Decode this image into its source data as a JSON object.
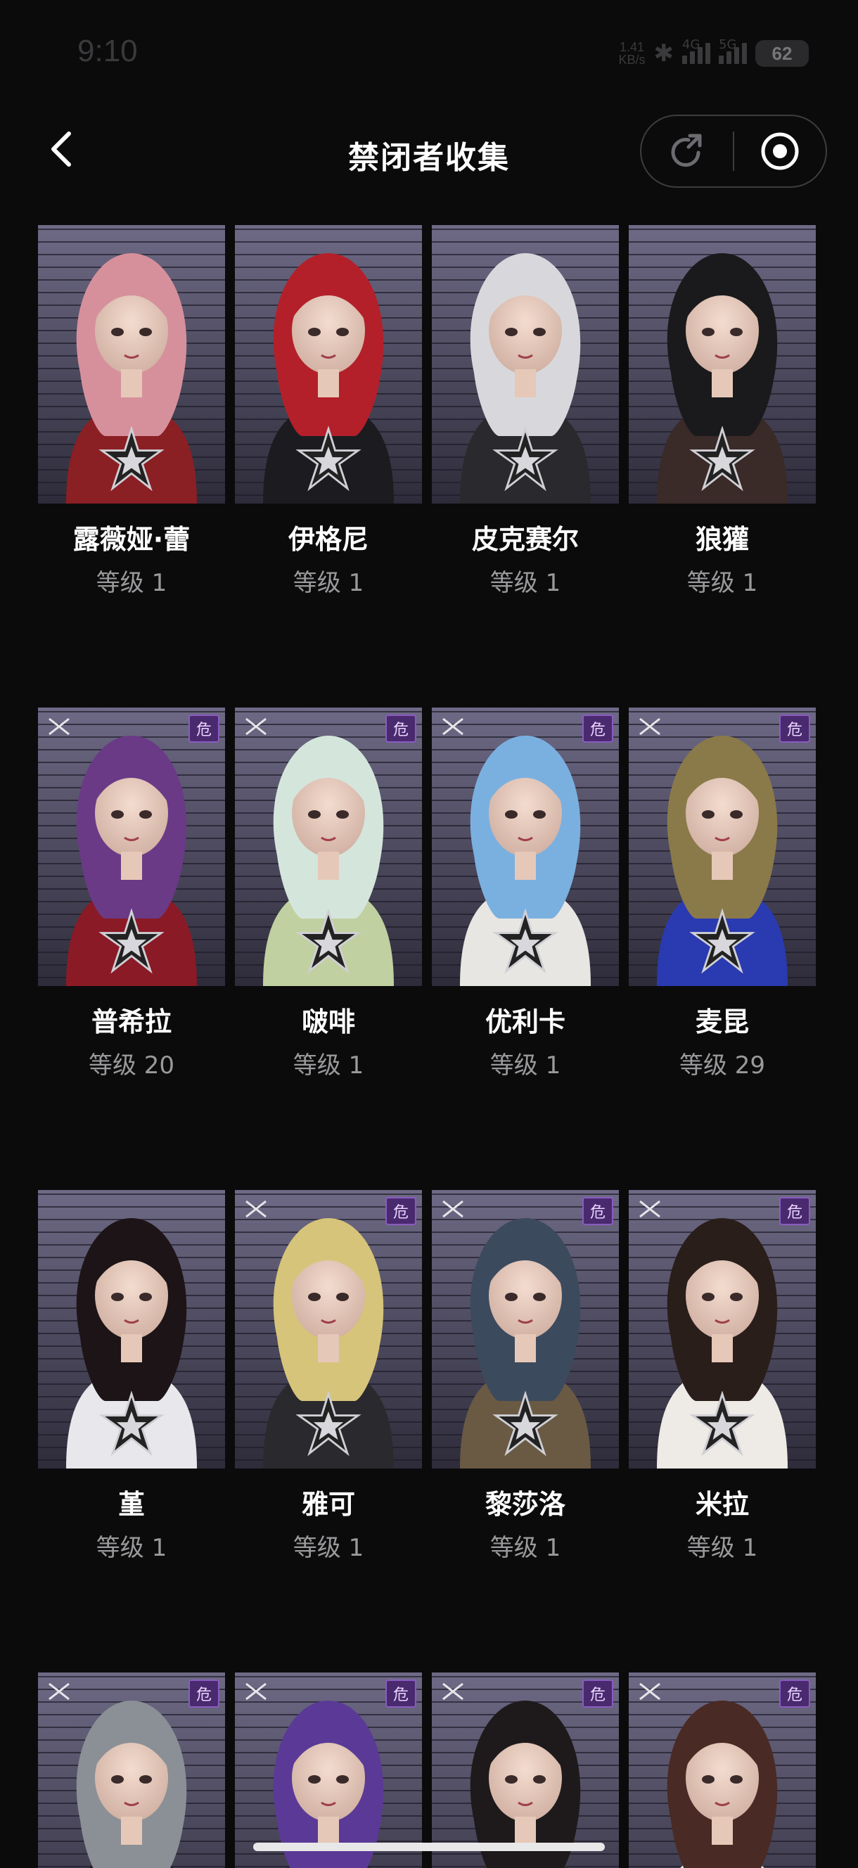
{
  "status": {
    "time": "9:10",
    "speed_value": "1.41",
    "speed_unit": "KB/s",
    "net1": "4G",
    "net2": "5G",
    "battery": "62"
  },
  "header": {
    "title": "禁闭者收集"
  },
  "colors": {
    "background": "#0b0b0c",
    "card_bg_top": "#6e6a86",
    "card_bg_bottom": "#2e2c3a",
    "level_text": "#9a9a9c",
    "danger_tag": "#4a2a6e"
  },
  "characters": [
    {
      "name": "露薇娅·蕾",
      "level": "等级 1",
      "tag": "",
      "hair": "#d6909c",
      "outfit": "#8a1f24"
    },
    {
      "name": "伊格尼",
      "level": "等级 1",
      "tag": "",
      "hair": "#b3202a",
      "outfit": "#1c1c20"
    },
    {
      "name": "皮克赛尔",
      "level": "等级 1",
      "tag": "",
      "hair": "#d8d8dc",
      "outfit": "#2a2a2e"
    },
    {
      "name": "狼獾",
      "level": "等级 1",
      "tag": "",
      "hair": "#1a1a1c",
      "outfit": "#3a2a28"
    },
    {
      "name": "普希拉",
      "level": "等级 20",
      "tag": "危",
      "hair": "#6a3a86",
      "outfit": "#8a1a26"
    },
    {
      "name": "啵啡",
      "level": "等级 1",
      "tag": "危",
      "hair": "#d4e6dc",
      "outfit": "#c0d0a0"
    },
    {
      "name": "优利卡",
      "level": "等级 1",
      "tag": "危",
      "hair": "#7ab0e0",
      "outfit": "#e8e6e2"
    },
    {
      "name": "麦昆",
      "level": "等级 29",
      "tag": "危",
      "hair": "#8a7a4a",
      "outfit": "#2a3ab0"
    },
    {
      "name": "堇",
      "level": "等级 1",
      "tag": "",
      "hair": "#1c1416",
      "outfit": "#e8e8ec"
    },
    {
      "name": "雅可",
      "level": "等级 1",
      "tag": "危",
      "hair": "#d6c47a",
      "outfit": "#2a2a2e"
    },
    {
      "name": "黎莎洛",
      "level": "等级 1",
      "tag": "危",
      "hair": "#3c4a5e",
      "outfit": "#6a5a44"
    },
    {
      "name": "米拉",
      "level": "等级 1",
      "tag": "危",
      "hair": "#2a1e1a",
      "outfit": "#eeeae6"
    },
    {
      "name": "",
      "level": "",
      "tag": "危",
      "hair": "#8a9096",
      "outfit": "#1e1e22"
    },
    {
      "name": "",
      "level": "",
      "tag": "危",
      "hair": "#5a3a96",
      "outfit": "#2a2a30"
    },
    {
      "name": "",
      "level": "",
      "tag": "危",
      "hair": "#1e1a1c",
      "outfit": "#3a2e26"
    },
    {
      "name": "",
      "level": "",
      "tag": "危",
      "hair": "#4a2a24",
      "outfit": "#e8e4e0"
    }
  ]
}
